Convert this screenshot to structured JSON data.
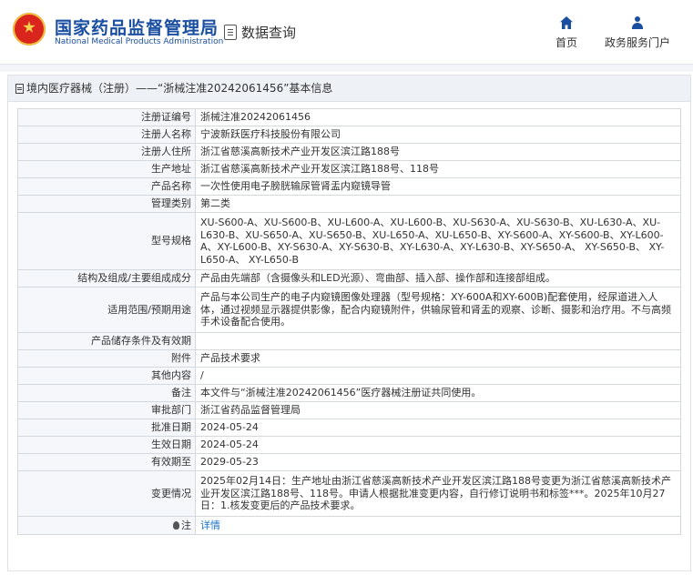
{
  "header": {
    "brand_cn": "国家药品监督管理局",
    "brand_en": "National Medical Products Administration",
    "query_label": "数据查询",
    "nav": [
      {
        "label": "首页",
        "icon": "home-icon"
      },
      {
        "label": "政务服务门户",
        "icon": "user-icon"
      }
    ]
  },
  "panel": {
    "title": "境内医疗器械（注册）——“浙械注准20242061456”基本信息",
    "rows": [
      {
        "key": "注册证编号",
        "value": "浙械注准20242061456"
      },
      {
        "key": "注册人名称",
        "value": "宁波新跃医疗科技股份有限公司"
      },
      {
        "key": "注册人住所",
        "value": "浙江省慈溪高新技术产业开发区滨江路188号"
      },
      {
        "key": "生产地址",
        "value": "浙江省慈溪高新技术产业开发区滨江路188号、118号"
      },
      {
        "key": "产品名称",
        "value": "一次性使用电子膀胱输尿管肾盂内窥镜导管"
      },
      {
        "key": "管理类别",
        "value": "第二类"
      },
      {
        "key": "型号规格",
        "value": "XU-S600-A、XU-S600-B、XU-L600-A、XU-L600-B、XU-S630-A、XU-S630-B、XU-L630-A、XU-L630-B、XU-S650-A、XU-S650-B、XU-L650-A、XU-L650-B、XY-S600-A、XY-S600-B、XY-L600-A、XY-L600-B、XY-S630-A、XY-S630-B、XY-L630-A、XY-L630-B、XY-S650-A、 XY-S650-B、 XY-L650-A、 XY-L650-B"
      },
      {
        "key": "结构及组成/主要组成成分",
        "value": "产品由先端部（含摄像头和LED光源）、弯曲部、插入部、操作部和连接部组成。"
      },
      {
        "key": "适用范围/预期用途",
        "value": "产品与本公司生产的电子内窥镜图像处理器（型号规格：XY-600A和XY-600B)配套使用，经尿道进入人体，通过视频显示器提供影像，配合内窥镜附件，供输尿管和肾盂的观察、诊断、摄影和治疗用。不与高频手术设备配合使用。"
      },
      {
        "key": "产品储存条件及有效期",
        "value": ""
      },
      {
        "key": "附件",
        "value": "产品技术要求"
      },
      {
        "key": "其他内容",
        "value": "/"
      },
      {
        "key": "备注",
        "value": "本文件与“浙械注准20242061456”医疗器械注册证共同使用。"
      },
      {
        "key": "审批部门",
        "value": "浙江省药品监督管理局"
      },
      {
        "key": "批准日期",
        "value": "2024-05-24"
      },
      {
        "key": "生效日期",
        "value": "2024-05-24"
      },
      {
        "key": "有效期至",
        "value": "2029-05-23"
      },
      {
        "key": "变更情况",
        "value": "2025年02月14日：生产地址由浙江省慈溪高新技术产业开发区滨江路188号变更为浙江省慈溪高新技术产业开发区滨江路188号、118号。申请人根据批准变更内容，自行修订说明书和标签***。2025年10月27日：1.核发变更后的产品技术要求。"
      },
      {
        "key": "注",
        "value": "详情"
      }
    ]
  }
}
